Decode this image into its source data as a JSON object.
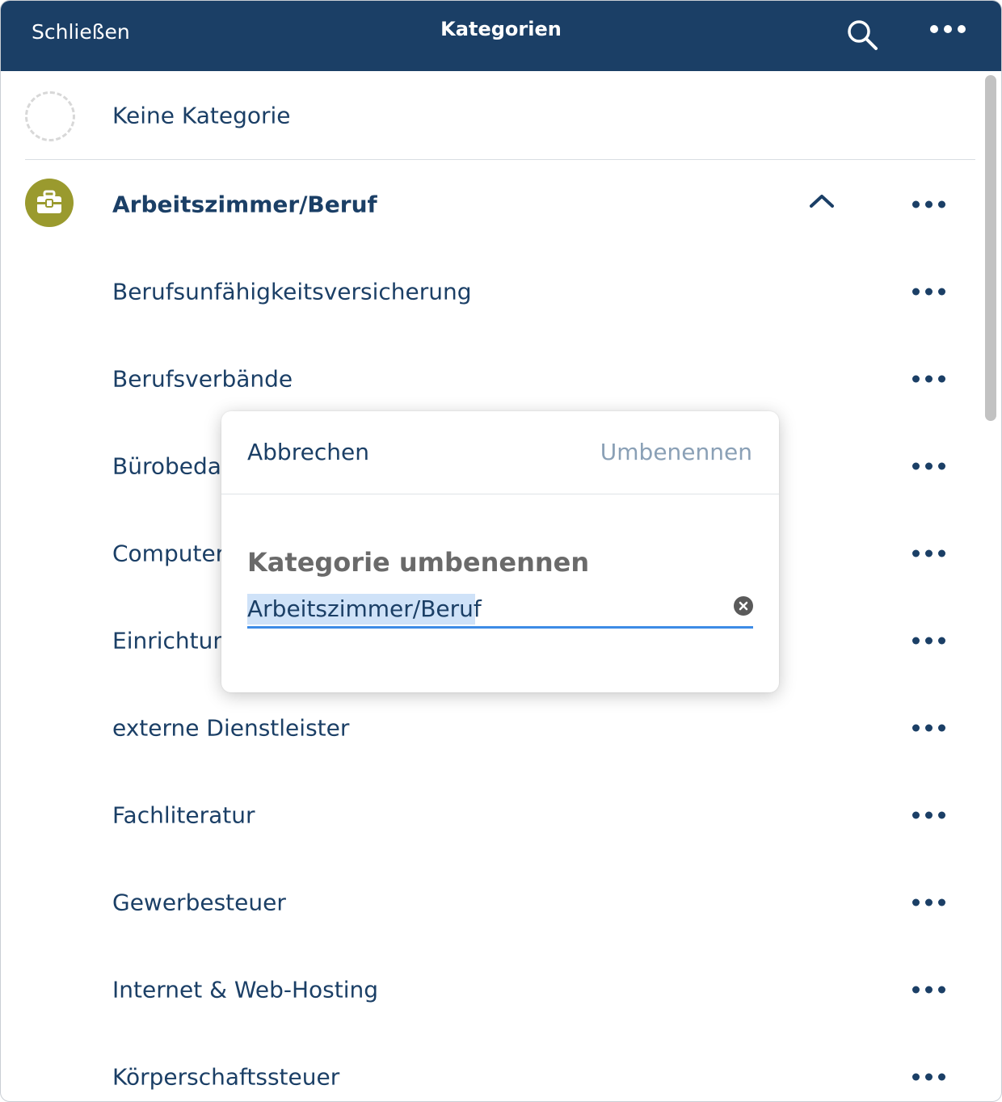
{
  "header": {
    "close_label": "Schließen",
    "title": "Kategorien",
    "search_icon": "search-icon",
    "more_icon": "more-horizontal-icon"
  },
  "list": {
    "no_category": "Keine Kategorie",
    "expanded_category": {
      "label": "Arbeitszimmer/Beruf",
      "icon": "briefcase-icon",
      "icon_color": "#9a9a2e"
    },
    "subcategories": [
      "Berufsunfähigkeitsversicherung",
      "Berufsverbände",
      "Bürobeda",
      "Computer",
      "Einrichtun",
      "externe Dienstleister",
      "Fachliteratur",
      "Gewerbesteuer",
      "Internet & Web-Hosting",
      "Körperschaftssteuer"
    ]
  },
  "dialog": {
    "cancel_label": "Abbrechen",
    "confirm_label": "Umbenennen",
    "title": "Kategorie umbenennen",
    "input_value": "Arbeitszimmer/Beruf",
    "accent_color": "#3d8be6"
  },
  "colors": {
    "header_bg": "#1b3f66",
    "text": "#1b3f66",
    "disabled": "#8aa0b6"
  }
}
